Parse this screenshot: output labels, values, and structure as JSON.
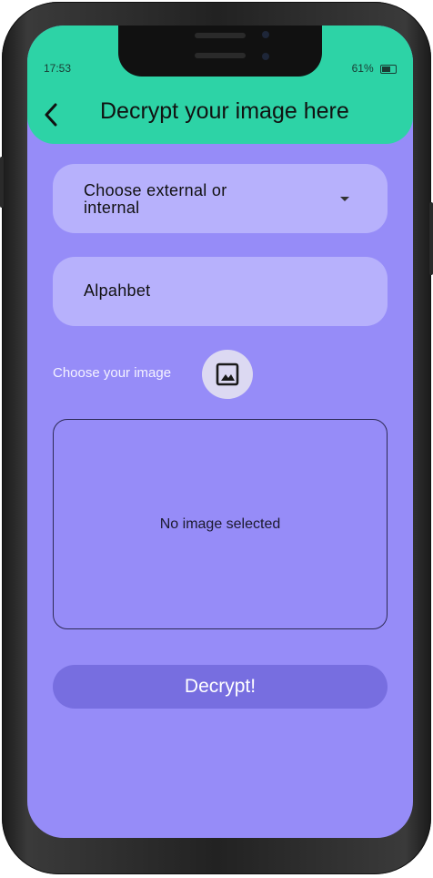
{
  "status_bar": {
    "time": "17:53",
    "battery": "61%"
  },
  "appbar": {
    "title": "Decrypt your image here"
  },
  "form": {
    "source_select_value": "Choose external or internal",
    "alphabet_field_value": "Alpahbet",
    "choose_image_label": "Choose your image",
    "preview_empty_text": "No image selected",
    "decrypt_button_label": "Decrypt!"
  },
  "icons": {
    "back": "back-arrow-icon",
    "image": "image-icon",
    "dropdown": "chevron-down-icon"
  },
  "colors": {
    "appbar": "#2dd3a6",
    "background": "#968cf8",
    "field": "#b7b1fc",
    "button": "#776ee0"
  }
}
